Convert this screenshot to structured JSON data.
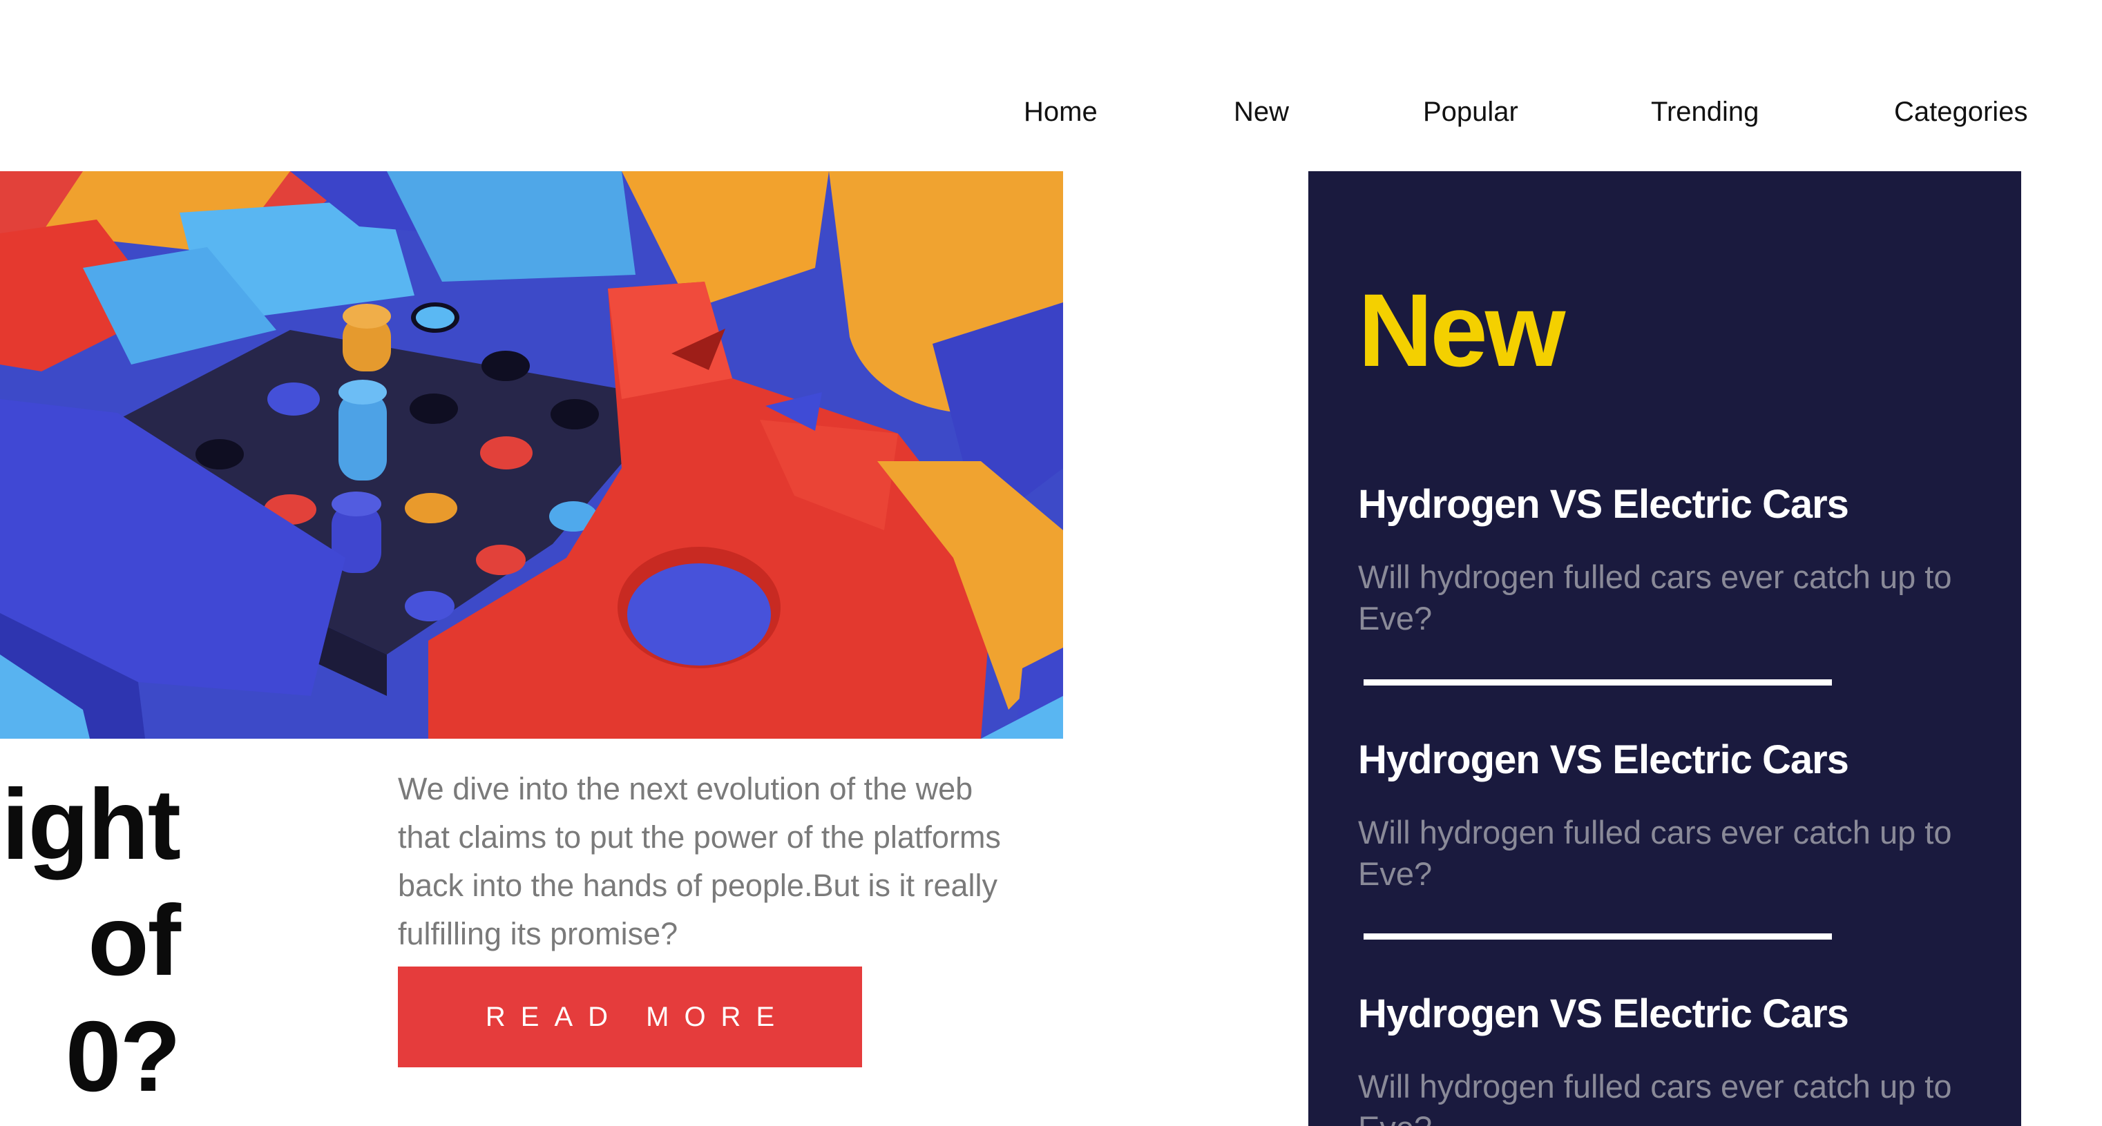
{
  "nav": {
    "items": [
      {
        "label": "Home"
      },
      {
        "label": "New"
      },
      {
        "label": "Popular"
      },
      {
        "label": "Trending"
      },
      {
        "label": "Categories"
      }
    ]
  },
  "hero": {
    "headline_lines": [
      "ight",
      "of",
      "0?"
    ],
    "excerpt": "We dive into the next evolution of the web that claims to put the power of the platforms back into the hands of people.But is it really fulfilling its promise?",
    "read_more_label": "READ MORE",
    "image_icon": "colorful-3d-blocks-illustration"
  },
  "sidebar": {
    "title": "New",
    "items": [
      {
        "title": "Hydrogen VS Electric Cars",
        "description": "Will hydrogen fulled cars ever catch up to Eve?"
      },
      {
        "title": "Hydrogen VS Electric Cars",
        "description": "Will hydrogen fulled cars ever catch up to Eve?"
      },
      {
        "title": "Hydrogen VS Electric Cars",
        "description": "Will hydrogen fulled cars ever catch up to Eve?"
      }
    ]
  },
  "colors": {
    "accent_red": "#e53c3c",
    "sidebar_bg": "#1a1a3e",
    "sidebar_title": "#f4d000"
  }
}
